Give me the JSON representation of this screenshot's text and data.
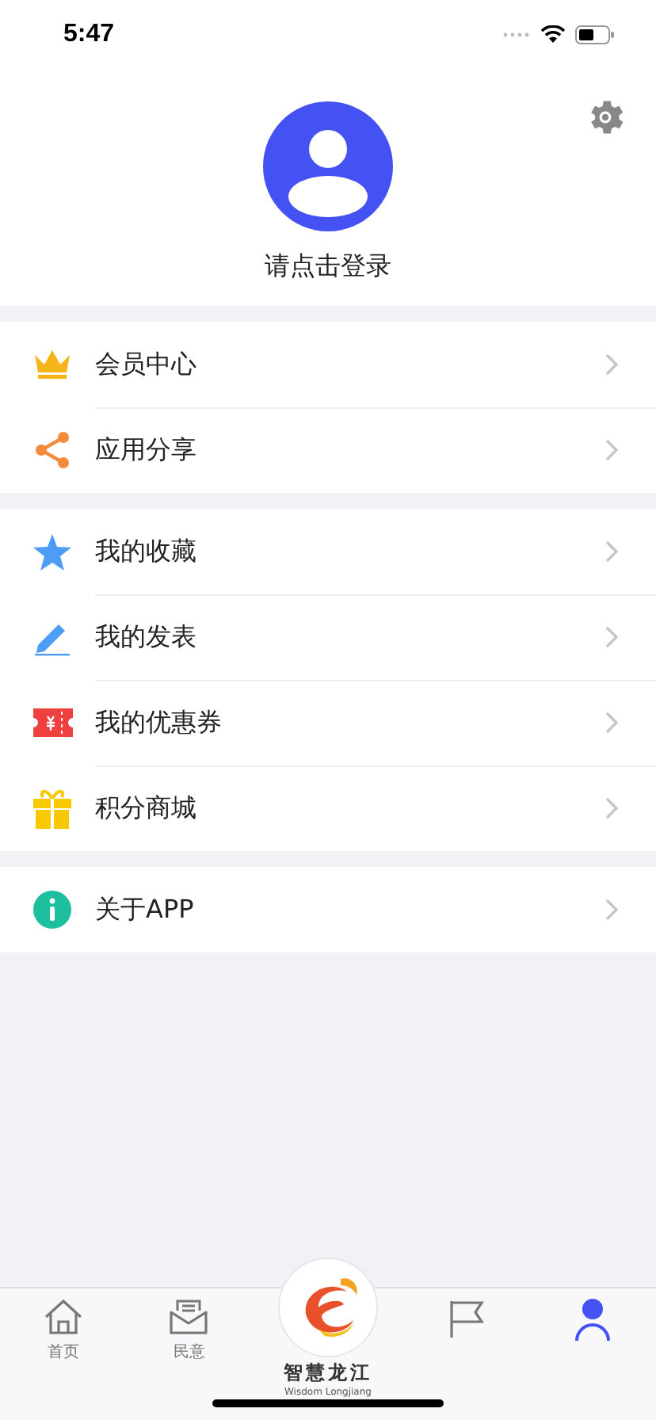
{
  "status_bar": {
    "time": "5:47"
  },
  "profile": {
    "login_prompt": "请点击登录"
  },
  "sections": [
    {
      "items": [
        {
          "label": "会员中心"
        },
        {
          "label": "应用分享"
        }
      ]
    },
    {
      "items": [
        {
          "label": "我的收藏"
        },
        {
          "label": "我的发表"
        },
        {
          "label": "我的优惠券"
        },
        {
          "label": "积分商城"
        }
      ]
    },
    {
      "items": [
        {
          "label": "关于APP"
        }
      ]
    }
  ],
  "tab_bar": {
    "items": [
      {
        "kind": "tab",
        "label": "首页",
        "selected": false
      },
      {
        "kind": "tab",
        "label": "民意",
        "selected": false
      },
      {
        "kind": "logo",
        "title": "智慧龙江",
        "subtitle": "Wisdom Longjiang"
      },
      {
        "kind": "tab",
        "selected": false
      },
      {
        "kind": "tab",
        "selected": true
      }
    ]
  }
}
